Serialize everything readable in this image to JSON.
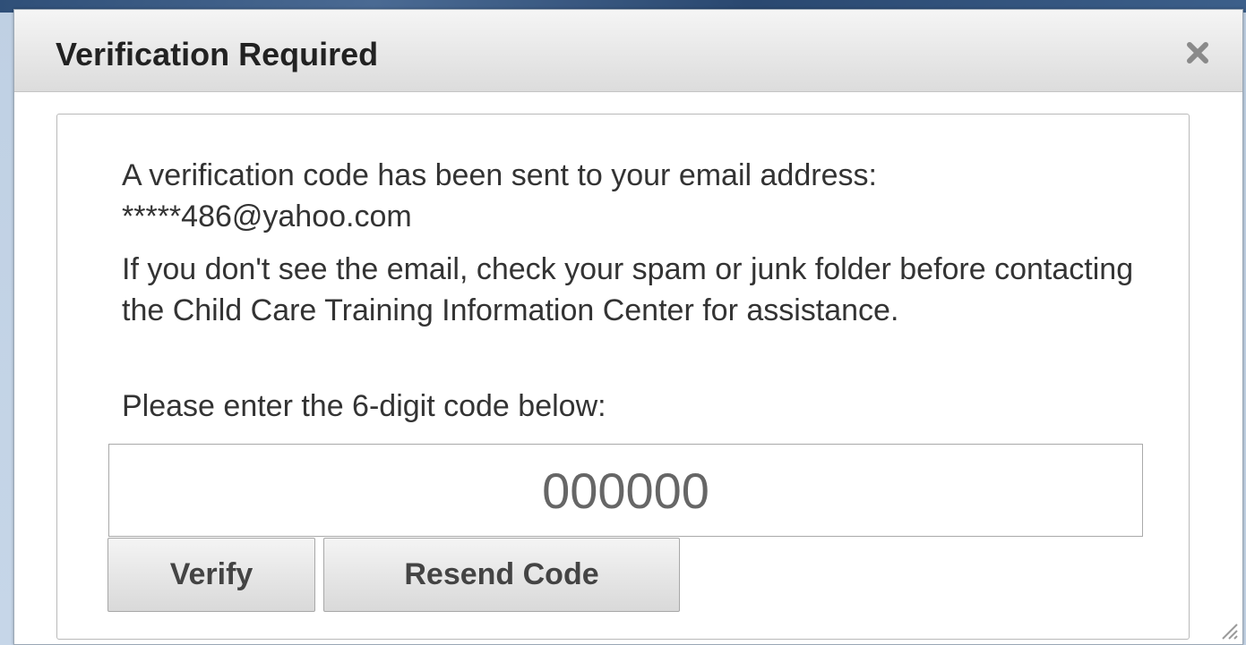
{
  "dialog": {
    "title": "Verification Required",
    "close_icon": "close-icon"
  },
  "content": {
    "sent_message": "A verification code has been sent to your email address: *****486@yahoo.com",
    "spam_message": "If you don't see the email, check your spam or junk folder before contacting the Child Care Training Information Center for assistance.",
    "prompt": "Please enter the 6-digit code below:",
    "code_placeholder": "000000"
  },
  "buttons": {
    "verify_label": "Verify",
    "resend_label": "Resend Code"
  }
}
